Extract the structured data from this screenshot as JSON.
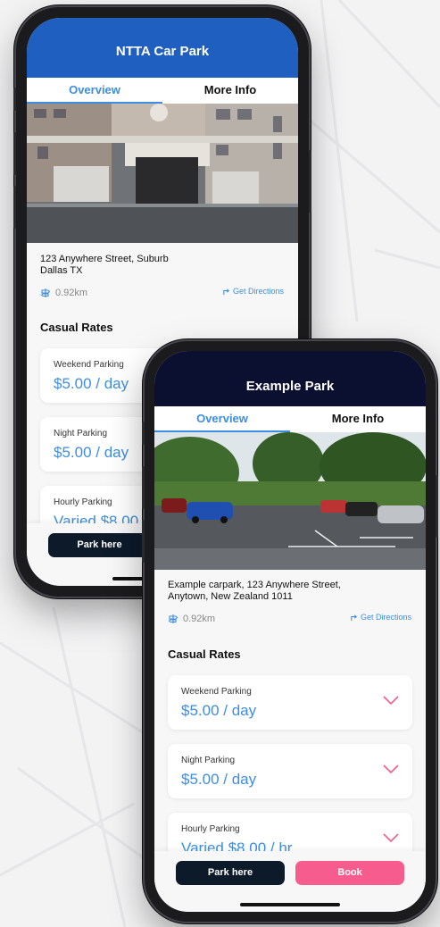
{
  "phone_a": {
    "title": "NTTA Car Park",
    "tabs": [
      "Overview",
      "More Info"
    ],
    "address_line1": "123 Anywhere Street, Suburb",
    "address_line2": "Dallas TX",
    "distance": "0.92km",
    "directions": "Get Directions",
    "section": "Casual Rates",
    "rates": [
      {
        "label": "Weekend Parking",
        "value": "$5.00 / day"
      },
      {
        "label": "Night Parking",
        "value": "$5.00 / day"
      },
      {
        "label": "Hourly Parking",
        "value": "Varied $8.00"
      }
    ],
    "park_label": "Park here"
  },
  "phone_b": {
    "title": "Example Park",
    "tabs": [
      "Overview",
      "More Info"
    ],
    "address_line1": "Example carpark, 123 Anywhere Street,",
    "address_line2": "Anytown, New Zealand 1011",
    "distance": "0.92km",
    "directions": "Get Directions",
    "section": "Casual Rates",
    "rates": [
      {
        "label": "Weekend Parking",
        "value": "$5.00 / day"
      },
      {
        "label": "Night Parking",
        "value": "$5.00 / day"
      },
      {
        "label": "Hourly Parking",
        "value": "Varied $8.00 / hr"
      }
    ],
    "park_label": "Park here",
    "book_label": "Book"
  },
  "colors": {
    "header_a": "#1f5fbf",
    "header_b": "#0c1030",
    "accent": "#3d8ee0",
    "book": "#f65c8e",
    "chevron": "#f65c8e"
  }
}
